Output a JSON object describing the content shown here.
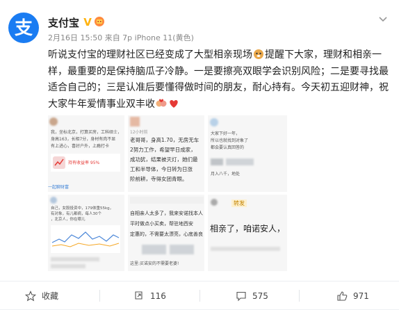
{
  "post": {
    "username": "支付宝",
    "meta": "2月16日 15:50 来自 7p iPhone 11(黄色)",
    "text_parts": [
      "听说支付宝的理财社区已经变成了大型相亲现场",
      "提醒下大家，理财和相亲一样，最重要的是保持脑瓜子冷静。一是要擦亮双眼学会识别风险；二是要寻找最适合自己的；三是认准后要懂得做时间的朋友，耐心持有。今天初五迎财神，祝大家牛年爱情事业双丰收"
    ]
  },
  "thumbs": [
    {
      "lines": [
        "我，坐标北京，打算买房，工科硕士，",
        "身高163，长相7分，身材有肉不显",
        "有上进心，喜好户外，上瘾打卡"
      ],
      "badge": "持有收益率 95%",
      "tag": "一起聊财富"
    },
    {
      "lines": [
        "12小时前",
        "老哥哥，身高1.70，无房无车",
        "2努力工作，希望早日成家，",
        "成功犹，结果被灭灯，她们最",
        "工和半导体，今日转为日涨",
        "阶前耕，寺得女团青眼。"
      ],
      "badge": "",
      "tag": ""
    },
    {
      "lines": [
        "大家下好一年，",
        "所以也就找到对象了",
        "都会要认真回答的",
        "月入八千，地处"
      ],
      "badge": "",
      "tag": ""
    },
    {
      "lines": [
        "自己，女股投资中，179体重55kg，",
        "有对象，有儿都病，每人30个",
        "，北京人，你在哪儿 "
      ],
      "badge": "",
      "tag": ""
    },
    {
      "lines": [
        "自相亲人太多了，我来安诺找本人",
        "平时做点小买卖，帮驻地西安",
        "定惠的，不需要太漂亮，心底善良",
        "这里:买诺安的不需要老婆!"
      ],
      "badge": "",
      "tag": ""
    },
    {
      "lines": [
        "相亲了，咱诺安人，",
        "转发"
      ],
      "badge": "",
      "tag": ""
    }
  ],
  "actions": {
    "favorite": "收藏",
    "repost_count": "116",
    "comment_count": "575",
    "like_count": "971"
  },
  "colors": {
    "brand": "#1a7cf2",
    "verified": "#ffb30f",
    "meta": "#888888",
    "text": "#222222"
  },
  "icons": {
    "avatar": "alipay-logo-icon",
    "verified": "verified-badge-icon",
    "vip": "vip-badge-icon",
    "caret": "chevron-down-icon",
    "favorite": "star-icon",
    "repost": "repost-icon",
    "comment": "comment-icon",
    "like": "like-icon"
  }
}
